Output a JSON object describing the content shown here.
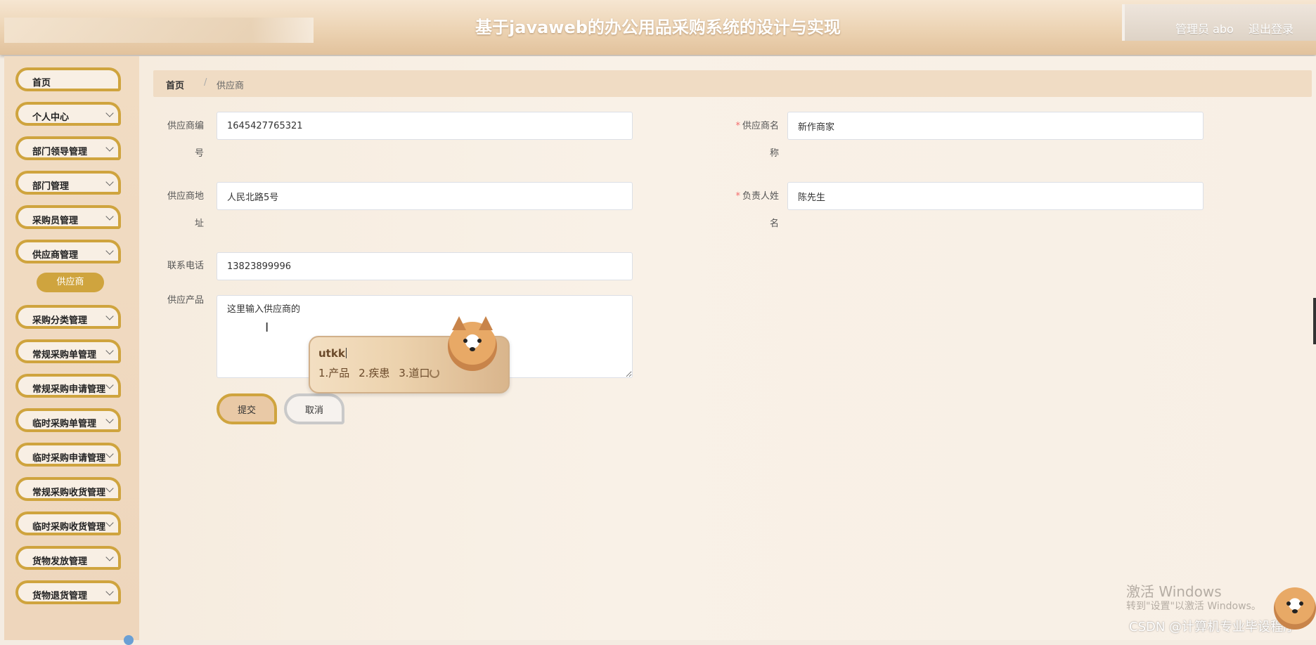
{
  "header": {
    "title": "基于javaweb的办公用品采购系统的设计与实现",
    "user": "管理员 abo",
    "logout": "退出登录"
  },
  "sidebar": {
    "items": [
      {
        "label": "首页"
      },
      {
        "label": "个人中心"
      },
      {
        "label": "部门领导管理"
      },
      {
        "label": "部门管理"
      },
      {
        "label": "采购员管理"
      },
      {
        "label": "供应商管理"
      },
      {
        "label": "采购分类管理"
      },
      {
        "label": "常规采购单管理"
      },
      {
        "label": "常规采购申请管理"
      },
      {
        "label": "临时采购单管理"
      },
      {
        "label": "临时采购申请管理"
      },
      {
        "label": "常规采购收货管理"
      },
      {
        "label": "临时采购收货管理"
      },
      {
        "label": "货物发放管理"
      },
      {
        "label": "货物退货管理"
      }
    ],
    "active_sub": "供应商"
  },
  "breadcrumb": {
    "home": "首页",
    "separator": "/",
    "current": "供应商"
  },
  "form": {
    "supplier_no": {
      "label_line1": "供应商编",
      "label_line2": "号",
      "value": "1645427765321"
    },
    "supplier_name": {
      "required": "*",
      "label_line1": "供应商名",
      "label_line2": "称",
      "value": "新作商家"
    },
    "supplier_addr": {
      "label_line1": "供应商地",
      "label_line2": "址",
      "value": "人民北路5号"
    },
    "contact_name": {
      "required": "*",
      "label_line1": "负责人姓",
      "label_line2": "名",
      "value": "陈先生"
    },
    "phone": {
      "label": "联系电话",
      "value": "13823899996"
    },
    "products": {
      "label": "供应产品",
      "value": "这里输入供应商的"
    },
    "submit": "提交",
    "cancel": "取消"
  },
  "ime": {
    "composition": "utkk",
    "candidates": [
      "1.产品",
      "2.疾患",
      "3.道口"
    ]
  },
  "watermark": {
    "activate_title": "激活 Windows",
    "activate_hint": "转到\"设置\"以激活 Windows。",
    "csdn": "CSDN @计算机专业毕设程序"
  },
  "icons": {
    "chevron": "chevron-down-icon",
    "ime_refresh": "refresh-icon",
    "text_cursor": "text-cursor-icon"
  }
}
